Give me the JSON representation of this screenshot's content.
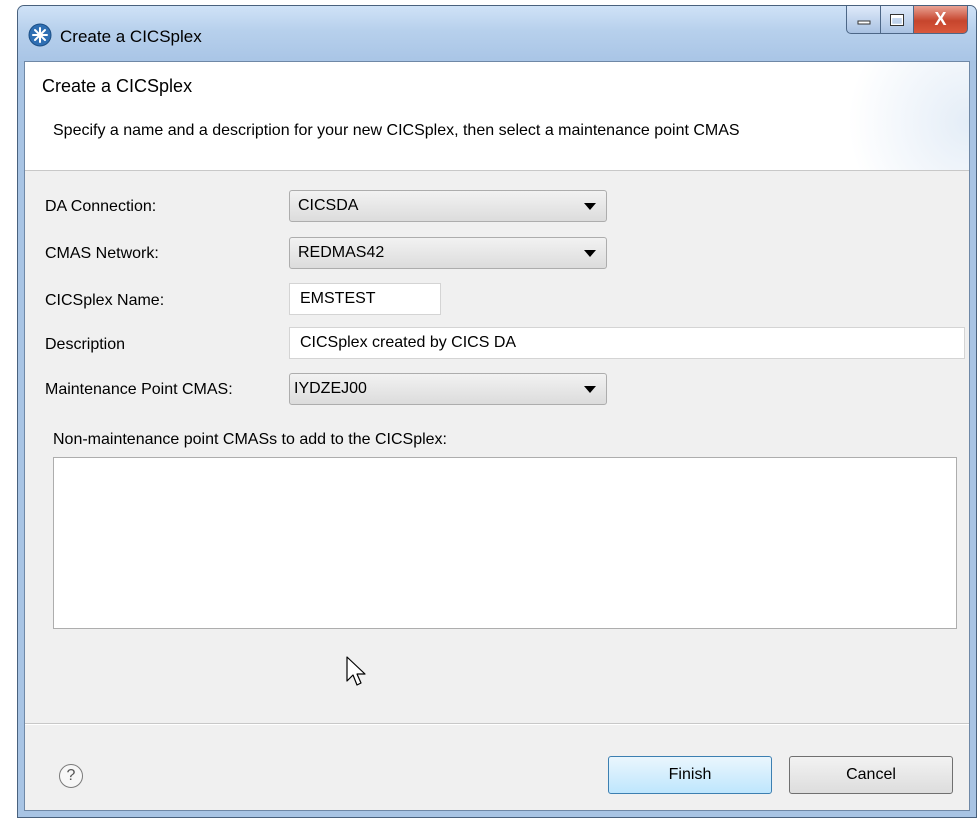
{
  "window": {
    "title": "Create a CICSplex",
    "icon": "cics-explorer-icon",
    "controls": {
      "minimize": "minimize-icon",
      "maximize": "maximize-icon",
      "close_label": "X"
    }
  },
  "header": {
    "title": "Create a CICSplex",
    "description": "Specify a name and a description for your new CICSplex, then select a maintenance point CMAS"
  },
  "form": {
    "da_connection": {
      "label": "DA Connection:",
      "value": "CICSDA"
    },
    "cmas_network": {
      "label": "CMAS Network:",
      "value": "REDMAS42"
    },
    "cicsplex_name": {
      "label": "CICSplex Name:",
      "value": "EMSTEST"
    },
    "description": {
      "label": "Description",
      "value": "CICSplex created by CICS DA"
    },
    "maintenance_point": {
      "label": "Maintenance Point CMAS:",
      "value": "IYDZEJ00"
    },
    "non_maintenance": {
      "label": "Non-maintenance point CMASs to add to the CICSplex:",
      "items": []
    }
  },
  "footer": {
    "help_symbol": "?",
    "finish_label": "Finish",
    "cancel_label": "Cancel"
  },
  "colors": {
    "accent": "#3c7fb1",
    "titlebar": "#b7d0ec",
    "close": "#c6452d"
  }
}
